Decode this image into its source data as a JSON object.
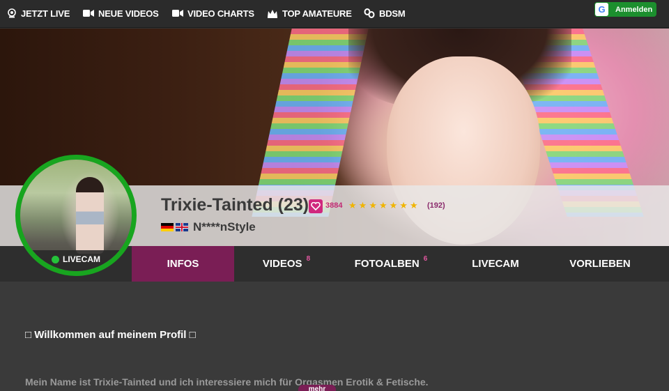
{
  "nav": {
    "items": [
      {
        "label": "JETZT LIVE",
        "icon": "webcam-icon"
      },
      {
        "label": "NEUE VIDEOS",
        "icon": "video-camera-icon"
      },
      {
        "label": "VIDEO CHARTS",
        "icon": "video-camera-icon"
      },
      {
        "label": "TOP AMATEURE",
        "icon": "crown-icon"
      },
      {
        "label": "BDSM",
        "icon": "chain-icon"
      }
    ],
    "login": {
      "icon_letter": "G",
      "label": "Anmelden"
    }
  },
  "profile": {
    "name": "Trixie-Tainted (23)",
    "fans_count": "3884",
    "rating_stars": 7,
    "rating_count": "(192)",
    "agency": "N****nStyle",
    "flags": [
      "de",
      "uk"
    ],
    "avatar_badge": "LIVECAM"
  },
  "tabs": [
    {
      "label": "INFOS",
      "count": "",
      "active": true
    },
    {
      "label": "VIDEOS",
      "count": "8",
      "active": false
    },
    {
      "label": "FOTOALBEN",
      "count": "6",
      "active": false
    },
    {
      "label": "LIVECAM",
      "count": "",
      "active": false
    },
    {
      "label": "VORLIEBEN",
      "count": "",
      "active": false
    }
  ],
  "content": {
    "welcome": "□ Willkommen auf meinem Profil □",
    "intro": "Mein Name ist Trixie-Tainted und ich interessiere mich für Orgasmen Erotik & Fetische.",
    "more_label": "mehr"
  },
  "colors": {
    "accent": "#7a1e55",
    "live_green": "#18a51f",
    "login_green": "#1c8f2e",
    "fans_pink": "#d0287e",
    "star": "#f0b400"
  }
}
